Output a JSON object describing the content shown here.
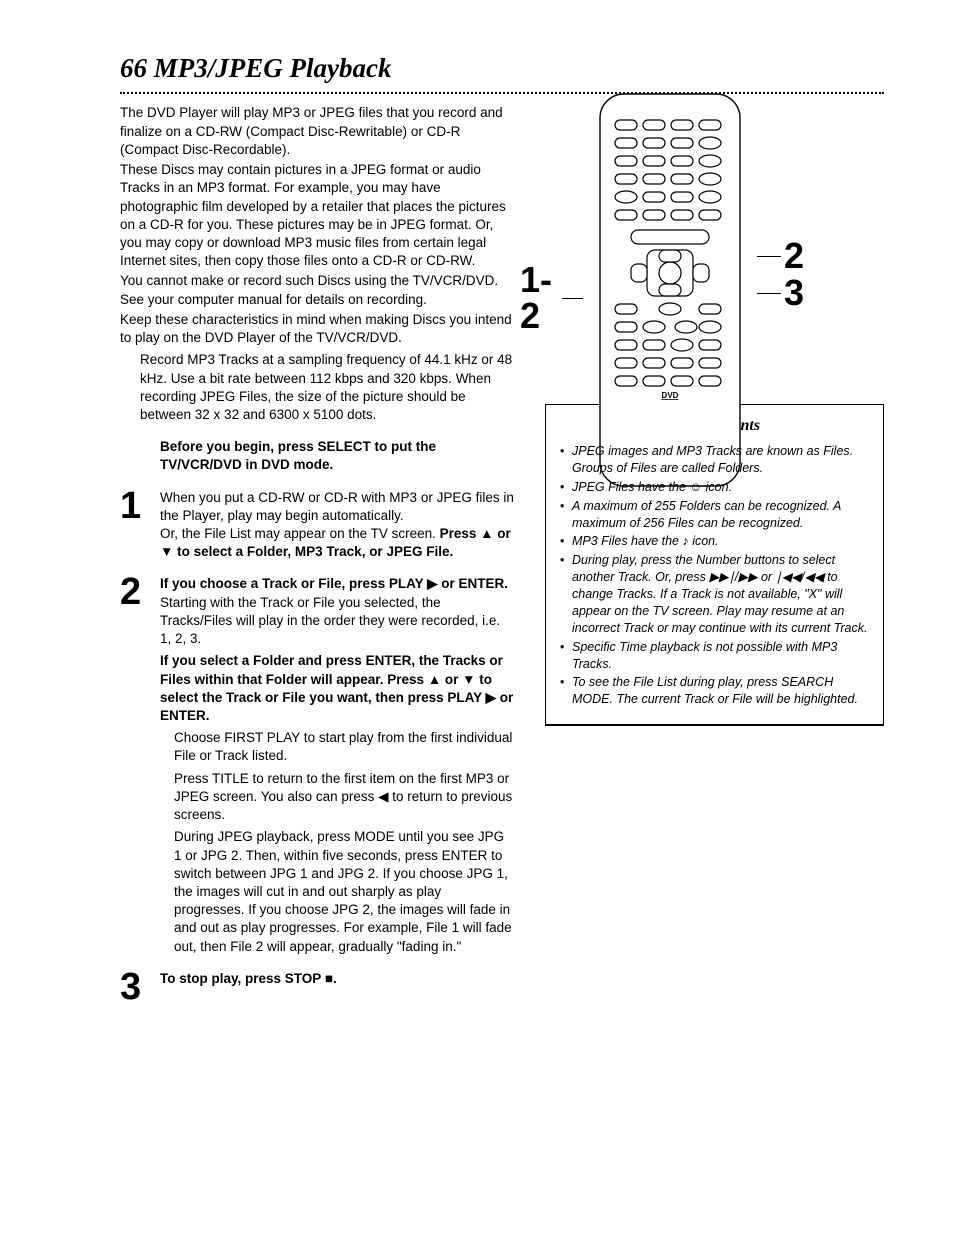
{
  "page_number": "66",
  "title": "MP3/JPEG Playback",
  "intro": {
    "p1": "The DVD Player will play MP3 or JPEG files that you record and finalize on a CD-RW (Compact Disc-Rewritable) or CD-R (Compact Disc-Recordable).",
    "p2": "These Discs may contain pictures in a JPEG format or audio Tracks in an MP3 format.  For example, you may have photographic film developed by a retailer that places the pictures on a CD-R for you.  These pictures may be in JPEG format. Or, you may copy or download MP3 music files from certain legal Internet sites, then copy those files onto a CD-R or CD-RW.",
    "p3": "You cannot make or record such Discs using the TV/VCR/DVD.  See your computer manual for details on recording.",
    "p4": "Keep these characteristics in mind when making Discs you intend to play on the DVD Player of the TV/VCR/DVD.",
    "p5": "Record MP3 Tracks at a sampling frequency of 44.1  kHz or 48 kHz. Use a bit rate between 112 kbps and 320 kbps. When recording JPEG Files, the size of the picture should be between 32 x 32 and 6300 x 5100 dots."
  },
  "before_begin": "Before you begin, press SELECT to put the TV/VCR/DVD in DVD mode.",
  "steps": {
    "s1": {
      "num": "1",
      "a": "When you put a CD-RW or CD-R with MP3 or JPEG files in the Player, play may begin automatically.",
      "b": "Or, the File List may appear on the TV screen. ",
      "b_bold": "Press ▲ or ▼ to select a Folder, MP3 Track, or JPEG File."
    },
    "s2": {
      "num": "2",
      "a_bold": "If you choose a Track or File, press PLAY ▶ or ENTER.",
      "a_rest": " Starting with the Track or File you selected, the Tracks/Files will play in the order they were recorded, i.e. 1, 2, 3.",
      "b_bold": "If you select a Folder and press ENTER, the Tracks or Files within that Folder will appear. Press ▲ or ▼ to select the Track or File you want, then press PLAY ▶ or ENTER.",
      "c": "Choose FIRST PLAY to start play from the first individual File or Track listed.",
      "d": "Press TITLE to return to the first item on the first MP3 or JPEG screen.  You also can press ◀ to return to previous screens.",
      "e": "During JPEG playback, press MODE until you see JPG 1 or JPG 2. Then, within five seconds, press ENTER to switch between JPG 1 and JPG 2. If you choose JPG 1, the images will cut in and out sharply as play progresses. If you choose JPG 2, the images will fade in and out as play progresses. For example, File 1 will fade out, then File 2 will appear, gradually \"fading in.\""
    },
    "s3": {
      "num": "3",
      "a_bold": "To stop play, press STOP ■."
    }
  },
  "callouts": {
    "left": "1-2",
    "right_top": "2",
    "right_bottom": "3"
  },
  "hints": {
    "title": "Helpful Hints",
    "items": [
      "JPEG images and MP3 Tracks are known as Files. Groups of Files are called Folders.",
      "JPEG Files have the ☺ icon.",
      "A maximum of 255 Folders can be recognized. A maximum of 256 Files can be recognized.",
      "MP3 Files have the ♪ icon.",
      "During play, press the Number buttons to select another Track. Or, press ▶▶∣/▶▶ or ∣◀◀/◀◀ to change Tracks. If a Track is not available, \"X\" will appear on the TV screen. Play may resume at an incorrect Track or may continue with its current Track.",
      "Specific Time playback is not possible with MP3 Tracks.",
      "To see the File List during play, press SEARCH MODE. The current Track or File will be highlighted."
    ]
  }
}
